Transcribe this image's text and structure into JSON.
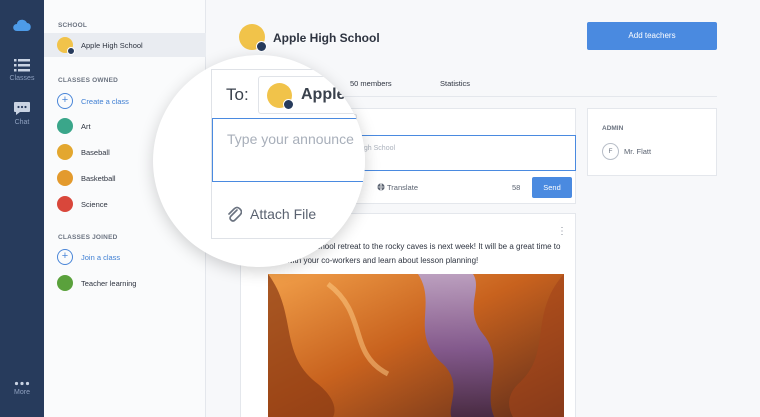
{
  "rail": {
    "items": [
      {
        "label": "Classes",
        "icon": "list-icon"
      },
      {
        "label": "Chat",
        "icon": "chat-icon"
      },
      {
        "label": "More",
        "icon": "more-icon"
      }
    ],
    "logo": "cloud-logo-icon"
  },
  "sidebar": {
    "school_heading": "SCHOOL",
    "school_name": "Apple High School",
    "owned_heading": "CLASSES OWNED",
    "create_label": "Create a class",
    "owned": [
      {
        "name": "Art",
        "color": "#3aa68a"
      },
      {
        "name": "Baseball",
        "color": "#e3a72f"
      },
      {
        "name": "Basketball",
        "color": "#e39a2d"
      },
      {
        "name": "Science",
        "color": "#d9473b"
      }
    ],
    "joined_heading": "CLASSES JOINED",
    "join_label": "Join a class",
    "joined": [
      {
        "name": "Teacher learning",
        "color": "#5aa13c"
      }
    ]
  },
  "main": {
    "title": "Apple High School",
    "add_button": "Add teachers",
    "tabs": [
      "50 members",
      "Statistics"
    ],
    "composer": {
      "to_chip_partial": "ol",
      "placeholder_partial": "ple High School",
      "schedule_partial": "ule",
      "translate_label": "Translate",
      "char_count": "58",
      "send_label": "Send"
    },
    "admin": {
      "heading": "ADMIN",
      "initial": "F",
      "name": "Mr. Flatt"
    },
    "post": {
      "text": "member our school retreat to the rocky caves is next week! It will be a great time to bond with your co-workers and learn about lesson planning!",
      "menu": "⋮"
    }
  },
  "magnifier": {
    "to_label": "To:",
    "chip_text": "Apple",
    "placeholder": "Type your announce",
    "attach_label": "Attach File"
  },
  "colors": {
    "accent": "#4a8ae0",
    "rail": "#273b5c",
    "school_avatar": "#f1c34a"
  }
}
